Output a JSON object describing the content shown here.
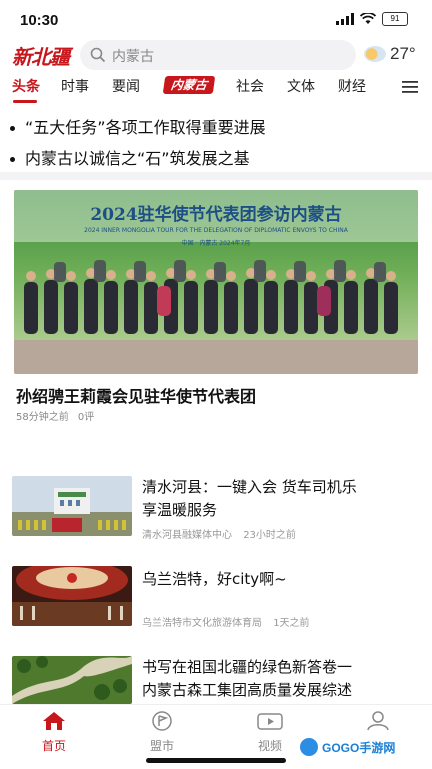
{
  "status": {
    "time": "10:30",
    "battery": "91"
  },
  "header": {
    "logo_text": "新北疆",
    "search_placeholder": "内蒙古",
    "temperature": "27°"
  },
  "tabs": [
    {
      "label": "头条",
      "active": true
    },
    {
      "label": "时事"
    },
    {
      "label": "要闻"
    },
    {
      "label": "内蒙古"
    },
    {
      "label": "社会"
    },
    {
      "label": "文体"
    },
    {
      "label": "财经"
    }
  ],
  "headlines": [
    "“五大任务”各项工作取得重要进展",
    "内蒙古以诚信之“石”筑发展之基"
  ],
  "hero": {
    "banner_title": "2024驻华使节代表团参访内蒙古",
    "banner_subtitle": "2024 INNER MONGOLIA TOUR FOR THE DELEGATION OF DIPLOMATIC ENVOYS TO CHINA",
    "banner_date": "中国 · 内蒙古   2024年7月",
    "title": "孙绍骋王莉霞会见驻华使节代表团",
    "time": "58分钟之前",
    "comments": "0评"
  },
  "articles": [
    {
      "title_line1": "清水河县：一键入会 货车司机乐",
      "title_line2": "享温暖服务",
      "source": "清水河县融媒体中心",
      "time": "23小时之前"
    },
    {
      "title_line1": "乌兰浩特，好city啊~",
      "title_line2": "",
      "source": "乌兰浩特市文化旅游体育局",
      "time": "1天之前"
    },
    {
      "title_line1": "书写在祖国北疆的绿色新答卷一",
      "title_line2": "内蒙古森工集团高质量发展综述",
      "source": "",
      "time": ""
    }
  ],
  "tabbar": [
    {
      "label": "首页",
      "icon": "home-icon",
      "active": true
    },
    {
      "label": "盟市",
      "icon": "flag-icon"
    },
    {
      "label": "视频",
      "icon": "video-icon"
    },
    {
      "label": "我的",
      "icon": "user-icon"
    }
  ],
  "watermark": "GOGO手游网",
  "colors": {
    "accent": "#c8161d",
    "divider": "#f3f3f5"
  }
}
